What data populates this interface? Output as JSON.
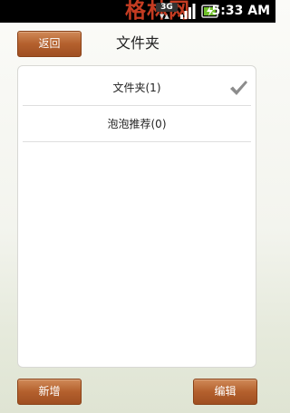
{
  "status_bar": {
    "watermark": "格林网",
    "network_type": "3G",
    "signal_icon": "signal-bars-icon",
    "battery_icon": "battery-charging-icon",
    "time": "5:33 AM"
  },
  "header": {
    "back_label": "返回",
    "title": "文件夹"
  },
  "folders": [
    {
      "label": "文件夹(1)",
      "selected": true
    },
    {
      "label": "泡泡推荐(0)",
      "selected": false
    }
  ],
  "footer": {
    "new_label": "新增",
    "edit_label": "编辑"
  },
  "colors": {
    "button_brown": "#b4602d",
    "status_bar": "#000000",
    "checkmark": "#8c8c8c"
  }
}
